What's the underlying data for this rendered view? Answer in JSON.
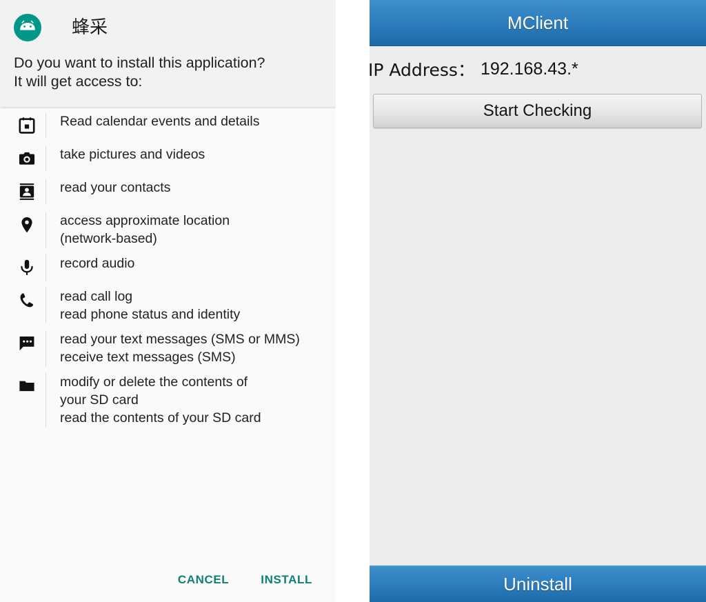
{
  "install_dialog": {
    "app_icon": "android-robot-icon",
    "app_name": "蜂采",
    "question_line1": "Do you want to install this application?",
    "question_line2": "It will get access to:",
    "permissions": [
      {
        "icon": "calendar-icon",
        "lines": [
          "Read calendar events and details"
        ]
      },
      {
        "icon": "camera-icon",
        "lines": [
          "take pictures and videos"
        ]
      },
      {
        "icon": "contacts-icon",
        "lines": [
          "read your contacts"
        ]
      },
      {
        "icon": "location-pin-icon",
        "lines": [
          "access approximate location\n(network-based)"
        ]
      },
      {
        "icon": "microphone-icon",
        "lines": [
          "record audio"
        ]
      },
      {
        "icon": "phone-icon",
        "lines": [
          "read call log",
          "read phone status and identity"
        ]
      },
      {
        "icon": "message-icon",
        "lines": [
          "read your text messages (SMS or MMS)",
          "receive text messages (SMS)"
        ]
      },
      {
        "icon": "folder-icon",
        "lines": [
          "modify or delete the contents of\nyour SD card",
          "read the contents of your SD card"
        ]
      }
    ],
    "cancel_label": "CANCEL",
    "install_label": "INSTALL",
    "accent_color": "#0e8074",
    "icon_bg_color": "#009789"
  },
  "mclient": {
    "title": "MClient",
    "ip_label": "IP Address：",
    "ip_value": "192.168.43.*",
    "start_checking_label": "Start Checking",
    "uninstall_label": "Uninstall",
    "titlebar_color": "#2f7fbf",
    "body_color": "#ededed"
  }
}
